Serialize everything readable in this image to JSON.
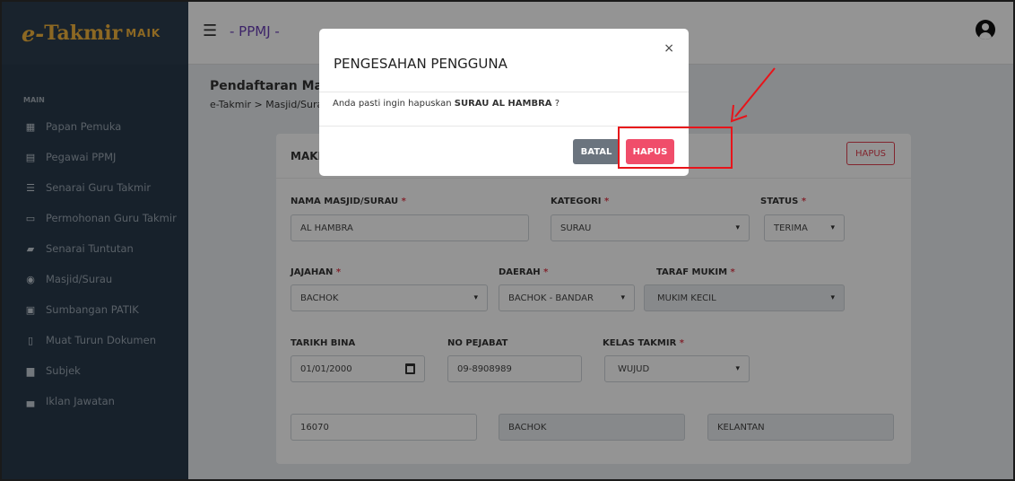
{
  "sidebar": {
    "logo_e": "e-",
    "logo_takmir": "Takmir",
    "logo_maik": "MAIK",
    "section": "MAIN",
    "items": [
      {
        "label": "Papan Pemuka",
        "icon": "dashboard-icon"
      },
      {
        "label": "Pegawai PPMJ",
        "icon": "id-card-icon"
      },
      {
        "label": "Senarai Guru Takmir",
        "icon": "list-icon"
      },
      {
        "label": "Permohonan Guru Takmir",
        "icon": "window-icon"
      },
      {
        "label": "Senarai Tuntutan",
        "icon": "folder-icon"
      },
      {
        "label": "Masjid/Surau",
        "icon": "location-pin-icon"
      },
      {
        "label": "Sumbangan PATIK",
        "icon": "gift-icon"
      },
      {
        "label": "Muat Turun Dokumen",
        "icon": "document-icon"
      },
      {
        "label": "Subjek",
        "icon": "book-icon"
      },
      {
        "label": "Iklan Jawatan",
        "icon": "briefcase-icon"
      }
    ]
  },
  "topbar": {
    "title": "- PPMJ -"
  },
  "page": {
    "title": "Pendaftaran Masjid/Surau",
    "breadcrumb": "e-Takmir  >  Masjid/Surau"
  },
  "card": {
    "header": "MAKLUMAT MASJID/SURAU",
    "hapus_label": "HAPUS",
    "fields": {
      "nama_label": "NAMA MASJID/SURAU",
      "nama_value": "AL HAMBRA",
      "kategori_label": "KATEGORI",
      "kategori_value": "SURAU",
      "status_label": "STATUS",
      "status_value": "TERIMA",
      "jajahan_label": "JAJAHAN",
      "jajahan_value": "BACHOK",
      "daerah_label": "DAERAH",
      "daerah_value": "BACHOK - BANDAR",
      "taraf_label": "TARAF MUKIM",
      "taraf_value": "MUKIM KECIL",
      "tarikh_label": "TARIKH BINA",
      "tarikh_value": "01/01/2000",
      "nopejabat_label": "NO PEJABAT",
      "nopejabat_value": "09-8908989",
      "kelas_label": "KELAS TAKMIR",
      "kelas_value": "WUJUD",
      "poskod_value": "16070",
      "bandar_value": "BACHOK",
      "negeri_value": "KELANTAN"
    },
    "required_mark": "*"
  },
  "modal": {
    "title": "PENGESAHAN PENGGUNA",
    "close": "×",
    "message_prefix": "Anda pasti ingin hapuskan ",
    "message_target": "SURAU AL HAMBRA",
    "message_suffix": " ?",
    "cancel_label": "BATAL",
    "delete_label": "HAPUS"
  },
  "colors": {
    "sidebar": "#28394a",
    "accent_logo": "#f2b33d",
    "danger": "#f04d6a",
    "annotation": "#e8141a"
  }
}
